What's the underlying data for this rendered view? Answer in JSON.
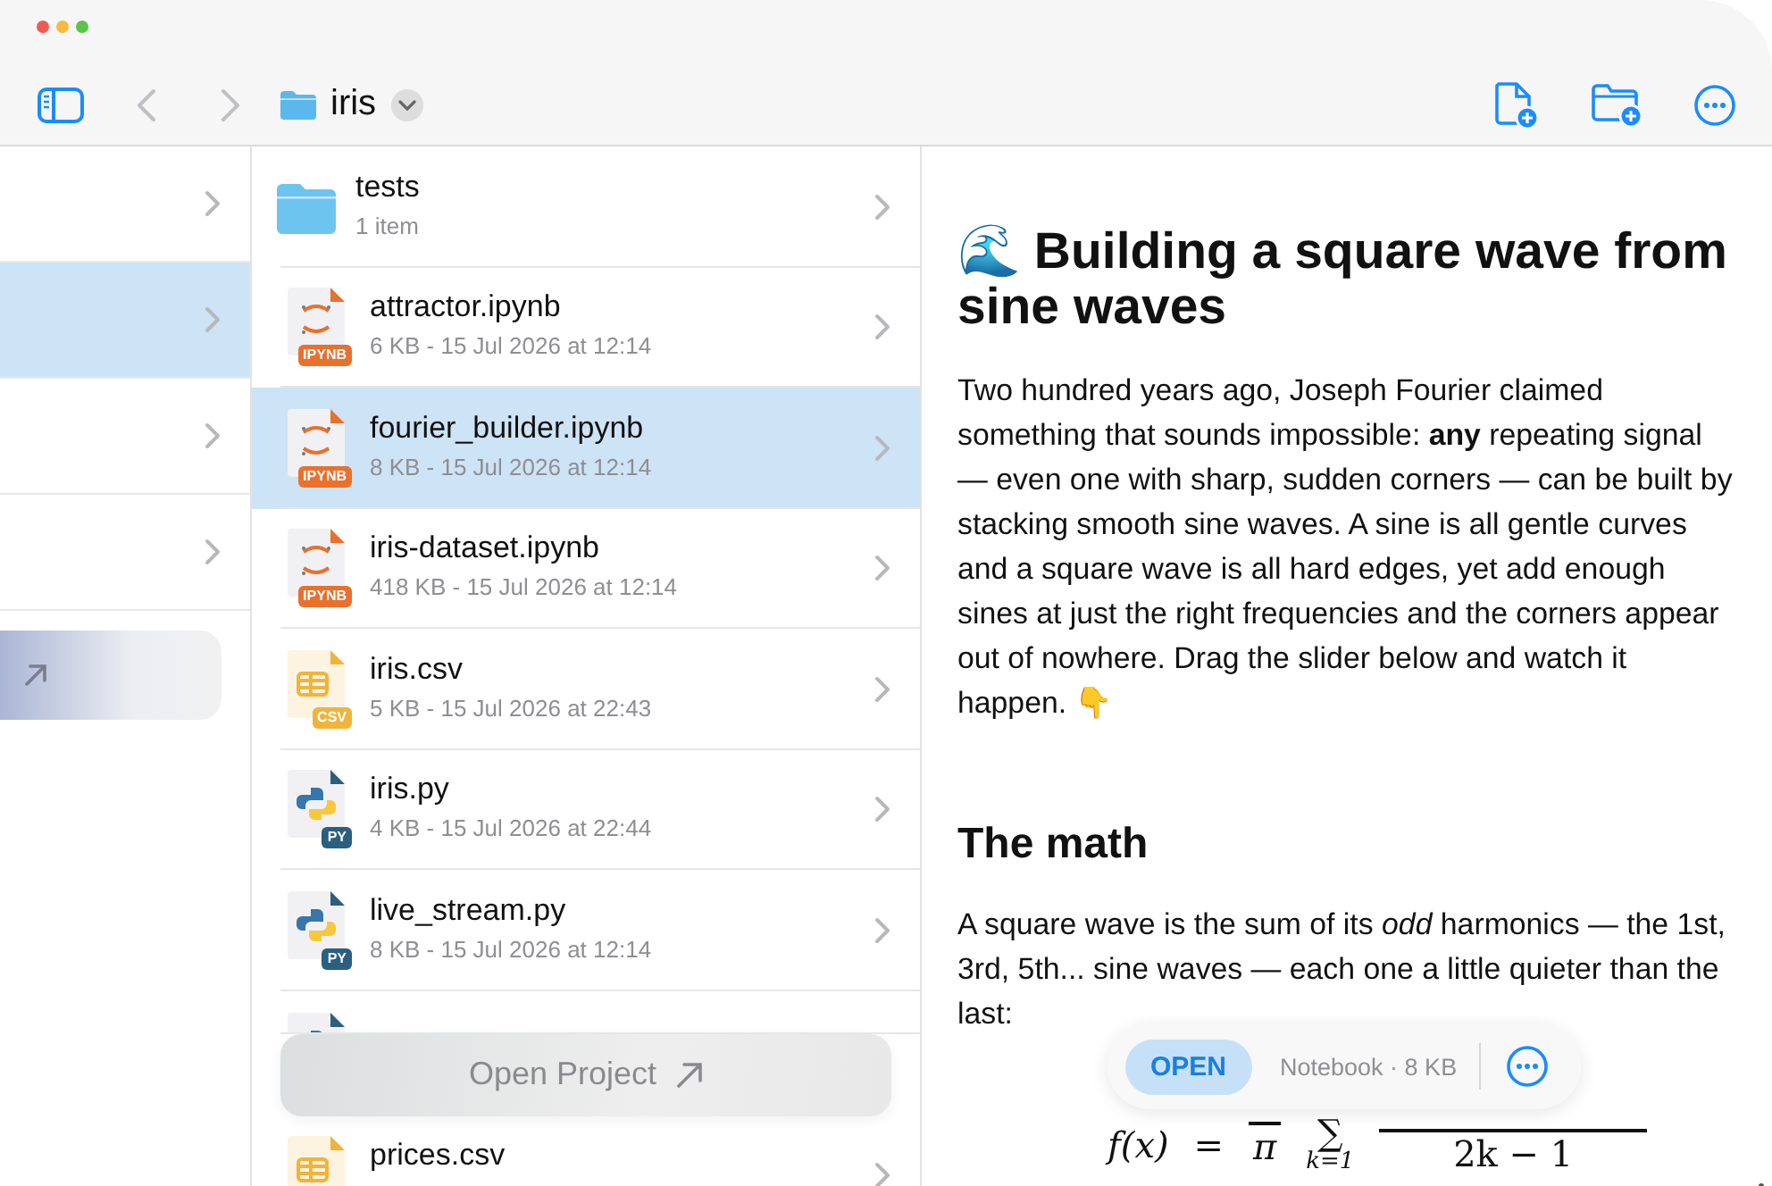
{
  "toolbar": {
    "folder_name": "iris"
  },
  "sidebar": {
    "items": [
      {
        "selected": false
      },
      {
        "selected": true
      },
      {
        "selected": false
      },
      {
        "selected": false
      }
    ]
  },
  "files": [
    {
      "kind": "folder",
      "name": "tests",
      "meta": "1 item",
      "selected": false
    },
    {
      "kind": "ipynb",
      "name": "attractor.ipynb",
      "meta": "6 KB - 15 Jul 2026 at 12:14",
      "badge": "IPYNB",
      "selected": false
    },
    {
      "kind": "ipynb",
      "name": "fourier_builder.ipynb",
      "meta": "8 KB - 15 Jul 2026 at 12:14",
      "badge": "IPYNB",
      "selected": true
    },
    {
      "kind": "ipynb",
      "name": "iris-dataset.ipynb",
      "meta": "418 KB - 15 Jul 2026 at 12:14",
      "badge": "IPYNB",
      "selected": false
    },
    {
      "kind": "csv",
      "name": "iris.csv",
      "meta": "5 KB - 15 Jul 2026 at 22:43",
      "badge": "CSV",
      "selected": false
    },
    {
      "kind": "py",
      "name": "iris.py",
      "meta": "4 KB - 15 Jul 2026 at 22:44",
      "badge": "PY",
      "selected": false
    },
    {
      "kind": "py",
      "name": "live_stream.py",
      "meta": "8 KB - 15 Jul 2026 at 12:14",
      "badge": "PY",
      "selected": false
    },
    {
      "kind": "py",
      "selected": false
    },
    {
      "kind": "csv",
      "name": "prices.csv",
      "selected": false
    }
  ],
  "open_project_button": {
    "label": "Open Project"
  },
  "document": {
    "title": "🌊 Building a square wave from sine waves",
    "intro": "Two hundred years ago, Joseph Fourier claimed something that sounds impossible: **any** repeating signal — even one with sharp, sudden corners — can be built by stacking smooth sine waves. A sine is all gentle curves and a square wave is all hard edges, yet add enough sines at just the right frequencies and the corners appear out of nowhere. Drag the slider below and watch it happen. 👇",
    "heading": "The math",
    "math_text": "A square wave is the sum of its *odd* harmonics — the 1st, 3rd, 5th... sine waves — each one a little quieter than the last:",
    "formula": {
      "lhs": "f(x)",
      "equals": "=",
      "coef_denominator": "π",
      "sum": "∑",
      "sum_index": "k=1",
      "denominator": "2k − 1"
    }
  },
  "info_bar": {
    "open_button": "OPEN",
    "info": "Notebook · 8 KB"
  }
}
